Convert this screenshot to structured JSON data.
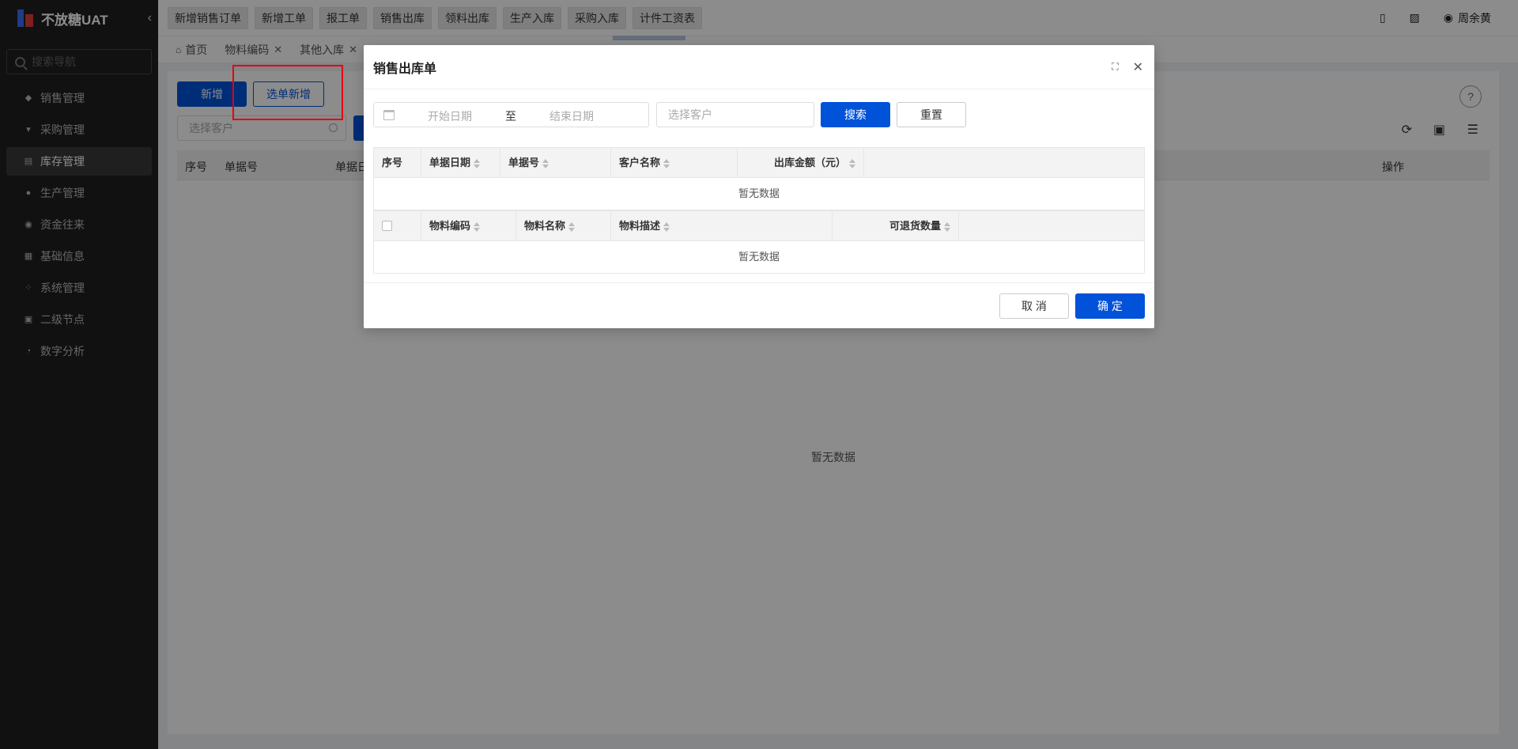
{
  "app": {
    "title": "不放糖UAT"
  },
  "sidebar": {
    "search_placeholder": "搜索导航",
    "items": [
      {
        "label": "销售管理",
        "icon": "tag-icon"
      },
      {
        "label": "采购管理",
        "icon": "cart-icon"
      },
      {
        "label": "库存管理",
        "icon": "inventory-icon",
        "active": true
      },
      {
        "label": "生产管理",
        "icon": "production-icon"
      },
      {
        "label": "资金往来",
        "icon": "money-icon"
      },
      {
        "label": "基础信息",
        "icon": "grid-icon"
      },
      {
        "label": "系统管理",
        "icon": "settings-icon"
      },
      {
        "label": "二级节点",
        "icon": "document-icon"
      },
      {
        "label": "数字分析",
        "icon": "pie-chart-icon"
      }
    ]
  },
  "topbar": {
    "quick_buttons": [
      "新增销售订单",
      "新增工单",
      "报工单",
      "销售出库",
      "领料出库",
      "生产入库",
      "采购入库",
      "计件工资表"
    ],
    "user_name": "周余黄"
  },
  "tabs": [
    {
      "label": "首页",
      "closable": false
    },
    {
      "label": "物料编码",
      "closable": true
    },
    {
      "label": "其他入库",
      "closable": true
    }
  ],
  "main": {
    "add_label": "新增",
    "select_add_label": "选单新增",
    "customer_placeholder": "选择客户",
    "columns": {
      "index": "序号",
      "doc_no": "单据号",
      "doc_date": "单据日",
      "action": "操作"
    },
    "empty_text": "暂无数据"
  },
  "modal": {
    "title": "销售出库单",
    "filter": {
      "start_placeholder": "开始日期",
      "range_sep": "至",
      "end_placeholder": "结束日期",
      "customer_placeholder": "选择客户",
      "search_label": "搜索",
      "reset_label": "重置"
    },
    "orders_table": {
      "columns": [
        "序号",
        "单据日期",
        "单据号",
        "客户名称",
        "出库金额（元）"
      ],
      "empty_text": "暂无数据"
    },
    "items_table": {
      "columns": [
        "物料编码",
        "物料名称",
        "物料描述",
        "可退货数量"
      ],
      "empty_text": "暂无数据"
    },
    "cancel_label": "取 消",
    "ok_label": "确 定"
  },
  "colors": {
    "primary": "#0052d9",
    "sidebar_bg": "#1f1f1f",
    "highlight": "#e60012"
  }
}
